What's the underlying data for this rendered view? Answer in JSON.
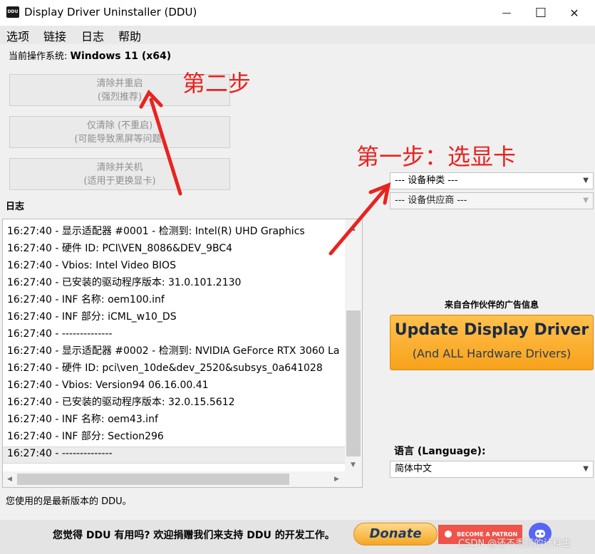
{
  "window": {
    "icon_text": "DDU",
    "title": "Display Driver Uninstaller (DDU)",
    "minimize_glyph": "—",
    "maximize_glyph": "☐",
    "close_glyph": "✕"
  },
  "menu": [
    "选项",
    "链接",
    "日志",
    "帮助"
  ],
  "os": {
    "label": "当前操作系统: ",
    "value": "Windows 11 (x64)"
  },
  "buttons": {
    "clean_restart": {
      "line1": "清除并重启",
      "line2": "(强烈推荐)"
    },
    "clean_only": {
      "line1": "仅清除 (不重启)",
      "line2": "(可能导致黑屏等问题)"
    },
    "clean_shutdown": {
      "line1": "清除并关机",
      "line2": "(适用于更换显卡)"
    }
  },
  "log": {
    "label": "日志",
    "lines": [
      "16:27:40 - 显示适配器 #0001 - 检测到: Intel(R) UHD Graphics",
      "16:27:40 - 硬件 ID: PCI\\VEN_8086&DEV_9BC4",
      "16:27:40 - Vbios: Intel Video BIOS",
      "16:27:40 - 已安装的驱动程序版本: 31.0.101.2130",
      "16:27:40 - INF 名称: oem100.inf",
      "16:27:40 - INF 部分: iCML_w10_DS",
      "16:27:40 - --------------",
      "16:27:40 - 显示适配器 #0002 - 检测到: NVIDIA GeForce RTX 3060 La",
      "16:27:40 - 硬件 ID: pci\\ven_10de&dev_2520&subsys_0a641028",
      "16:27:40 - Vbios: Version94 06.16.00.41",
      "16:27:40 - 已安装的驱动程序版本: 32.0.15.5612",
      "16:27:40 - INF 名称: oem43.inf",
      "16:27:40 - INF 部分: Section296",
      "16:27:40 - --------------"
    ]
  },
  "status": "您使用的是最新版本的 DDU。",
  "device_type": {
    "selected": "--- 设备种类 ---"
  },
  "device_vendor": {
    "selected": "--- 设备供应商 ---"
  },
  "ad": {
    "label": "来自合作伙伴的广告信息",
    "title": "Update Display Driver",
    "subtitle": "(And ALL Hardware Drivers)"
  },
  "language": {
    "label": "语言 (Language):",
    "selected": "简体中文"
  },
  "footer": {
    "donate_text": "您觉得 DDU 有用吗? 欢迎捐赠我们来支持 DDU 的开发工作。",
    "donate_label": "Donate",
    "patreon_label": "BECOME A PATRON"
  },
  "watermark": "CSDN @还不秃顶的计科生",
  "annotations": {
    "step2": "第二步",
    "step1": "第一步：选显卡"
  },
  "colors": {
    "annotation": "#e8231f",
    "ad_orange": "#f7a21b",
    "patreon": "#f0534a",
    "discord": "#5865f2"
  }
}
